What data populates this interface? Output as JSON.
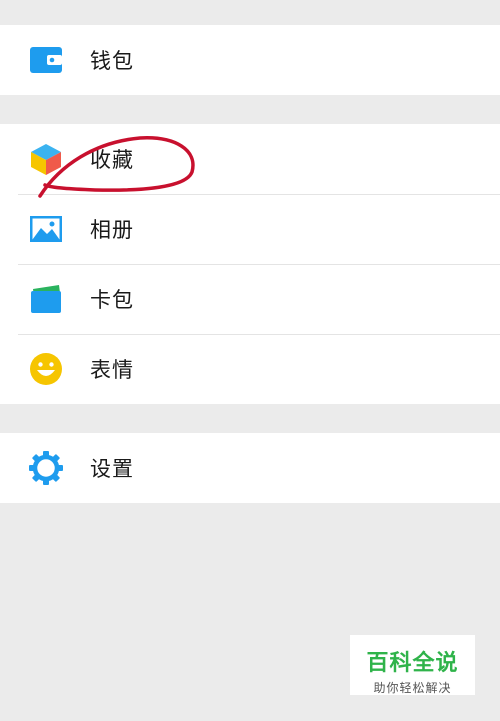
{
  "menu": {
    "group1": {
      "items": [
        {
          "label": "钱包",
          "icon": "wallet-icon"
        }
      ]
    },
    "group2": {
      "items": [
        {
          "label": "收藏",
          "icon": "favorites-cube-icon"
        },
        {
          "label": "相册",
          "icon": "album-icon"
        },
        {
          "label": "卡包",
          "icon": "card-wallet-icon"
        },
        {
          "label": "表情",
          "icon": "smiley-icon"
        }
      ]
    },
    "group3": {
      "items": [
        {
          "label": "设置",
          "icon": "settings-gear-icon"
        }
      ]
    }
  },
  "watermark": {
    "title": "百科全说",
    "subtitle": "助你轻松解决"
  },
  "colors": {
    "icon_blue": "#1e9cee",
    "icon_yellow": "#f6c500",
    "card_green": "#2ab35e",
    "annotation_red": "#c8102e",
    "watermark_green": "#2fb34a"
  }
}
